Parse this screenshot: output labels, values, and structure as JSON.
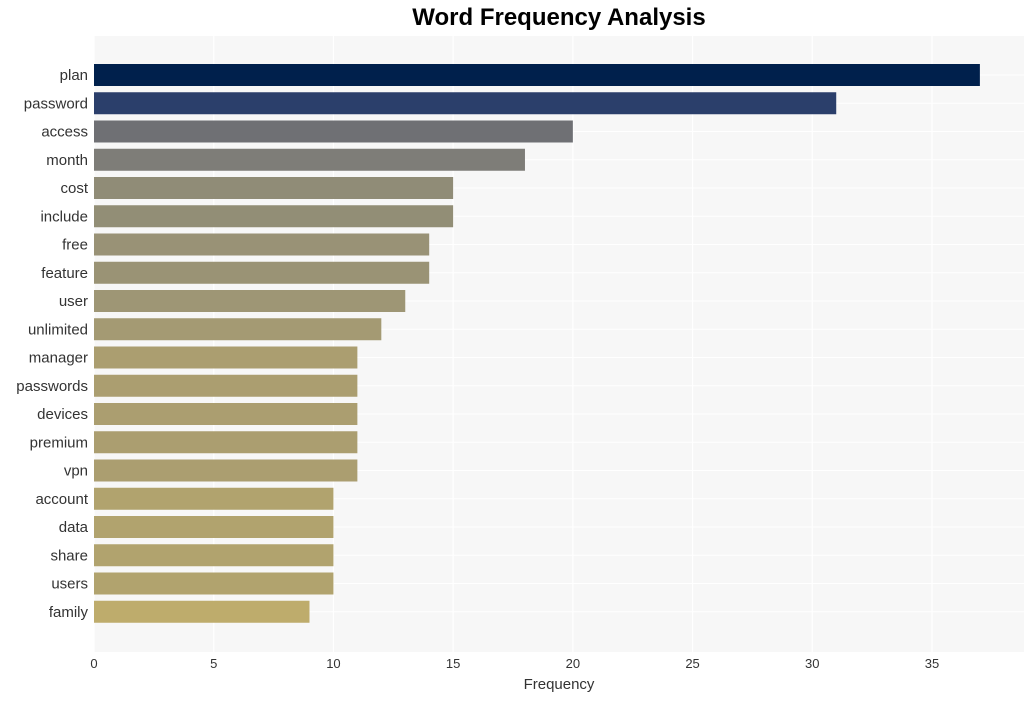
{
  "chart_data": {
    "type": "bar",
    "orientation": "horizontal",
    "title": "Word Frequency Analysis",
    "xlabel": "Frequency",
    "ylabel": "",
    "xlim": [
      0,
      38.8
    ],
    "xticks": [
      0,
      5,
      10,
      15,
      20,
      25,
      30,
      35
    ],
    "grid": true,
    "categories": [
      "plan",
      "password",
      "access",
      "month",
      "cost",
      "include",
      "free",
      "feature",
      "user",
      "unlimited",
      "manager",
      "passwords",
      "devices",
      "premium",
      "vpn",
      "account",
      "data",
      "share",
      "users",
      "family"
    ],
    "values": [
      37,
      31,
      20,
      18,
      15,
      15,
      14,
      14,
      13,
      12,
      11,
      11,
      11,
      11,
      11,
      10,
      10,
      10,
      10,
      9
    ],
    "colors": [
      "#00204c",
      "#2b3f6b",
      "#6f7074",
      "#7e7d78",
      "#908c77",
      "#928e76",
      "#999276",
      "#9a9375",
      "#9e9675",
      "#a49a73",
      "#ab9e70",
      "#ab9e70",
      "#ab9e70",
      "#ab9e70",
      "#ab9e70",
      "#b1a36e",
      "#b1a36e",
      "#b1a36e",
      "#b1a36e",
      "#beac6c"
    ]
  }
}
